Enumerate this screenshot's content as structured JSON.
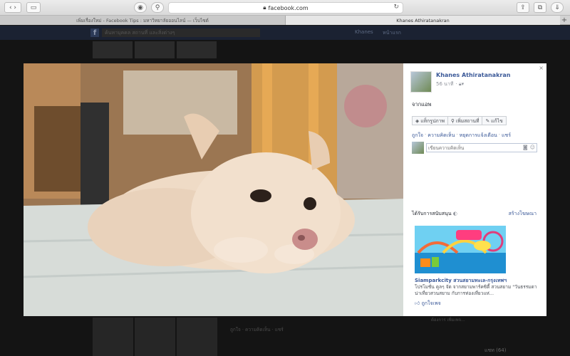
{
  "browser": {
    "url": "facebook.com",
    "tabs": [
      {
        "title": "เพิ่มเรื่องใหม่ - Facebook Tips : มหาวิทยาลัยออนไลน์ — เว็บไซต์"
      },
      {
        "title": "Khanes Athiratanakran"
      }
    ],
    "new_tab": "+"
  },
  "background_page": {
    "logo": "f",
    "search_placeholder": "ค้นหาบุคคล สถานที่ และสิ่งต่างๆ",
    "user_name": "Khanes",
    "home": "หน้าแรก",
    "thumbs": [
      "",
      "",
      ""
    ],
    "comment_text": "ถูกใจ · ความคิดเห็น · แชร์",
    "right_text": "ต้องการ เพิ่มเพจ...",
    "chat": "แชท (64)"
  },
  "lightbox": {
    "close": "×",
    "author": {
      "name": "Khanes Athiratanakran",
      "time": "56 นาที"
    },
    "caption": "จากแอพ",
    "actions": [
      {
        "label": "แท็กรูปภาพ",
        "icon": "tag-icon"
      },
      {
        "label": "เพิ่มสถานที่",
        "icon": "location-pin-icon"
      },
      {
        "label": "แก้ไข",
        "icon": "pencil-icon"
      }
    ],
    "links": [
      "ถูกใจ",
      "ความคิดเห็น",
      "หยุดการแจ้งเตือน",
      "แชร์"
    ],
    "comment_placeholder": "เขียนความคิดเห็น",
    "sponsored_label": "ได้รับการสนับสนุน",
    "create_ad": "สร้างโฆษณา",
    "ad": {
      "title": "Siamparkcity สวนสยามทะเล-กรุงเทพฯ",
      "description": "โปรโมชั่น คูลๆ จัด จากสยามพาร์คซิตี้ สวนสยาม \"วันธรรมดาน่าเที่ยวสวนสยาม กับการท่องเที่ยวแห่...",
      "like": "ถูกใจเพจ"
    }
  },
  "colors": {
    "fb_blue": "#3b5998",
    "dim": "#141414"
  }
}
